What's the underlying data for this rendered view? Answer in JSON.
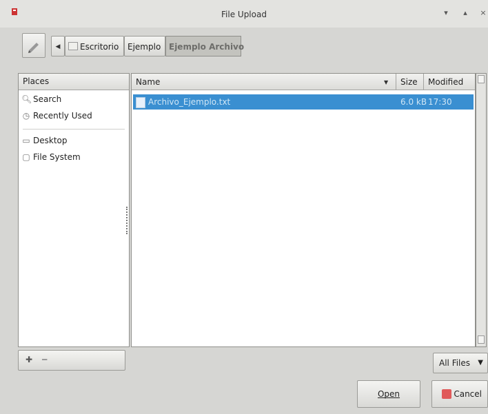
{
  "window": {
    "title": "File Upload",
    "controls": {
      "minimize": "▾",
      "maximize": "▴",
      "close": "×"
    }
  },
  "pathbar": {
    "crumbs": [
      "Escritorio",
      "Ejemplo",
      "Ejemplo Archivo"
    ]
  },
  "places": {
    "header": "Places",
    "items": [
      {
        "label": "Search",
        "icon": "search-icon"
      },
      {
        "label": "Recently Used",
        "icon": "clock-icon"
      },
      {
        "label": "Desktop",
        "icon": "folder-icon"
      },
      {
        "label": "File System",
        "icon": "drive-icon"
      }
    ]
  },
  "files": {
    "columns": {
      "name": "Name",
      "size": "Size",
      "modified": "Modified"
    },
    "rows": [
      {
        "name": "Archivo_Ejemplo.txt",
        "size": "6.0 kB",
        "modified": "17:30"
      }
    ]
  },
  "filter": {
    "selected": "All Files"
  },
  "buttons": {
    "open": "Open",
    "cancel": "Cancel"
  },
  "colors": {
    "selection": "#3a8fd1",
    "background": "#d6d6d3"
  }
}
